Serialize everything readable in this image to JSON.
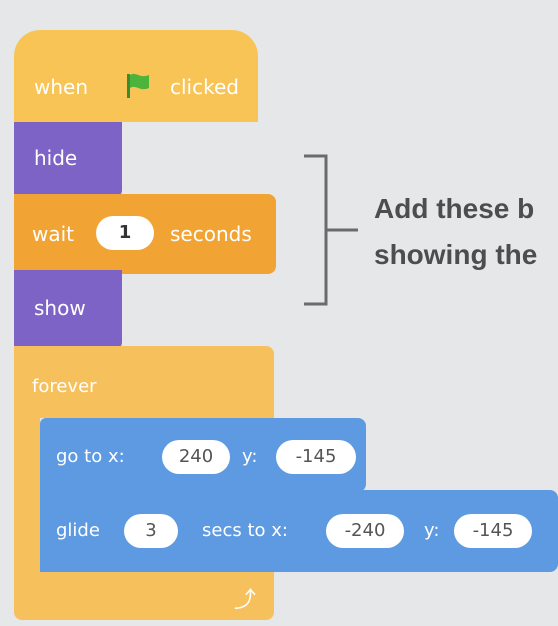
{
  "script": {
    "hat": {
      "when": "when",
      "flag_icon": "green-flag-icon",
      "clicked": "clicked"
    },
    "hide": {
      "label": "hide"
    },
    "wait": {
      "label": "wait",
      "value": "1",
      "unit": "seconds"
    },
    "show": {
      "label": "show"
    },
    "forever": {
      "label": "forever"
    },
    "goto": {
      "label": "go to x:",
      "x": "240",
      "y_label": "y:",
      "y": "-145"
    },
    "glide": {
      "label": "glide",
      "secs": "3",
      "secs_label": "secs to x:",
      "x": "-240",
      "y_label": "y:",
      "y": "-145"
    }
  },
  "annotation": {
    "line1": "Add these b",
    "line2": "showing the"
  },
  "colors": {
    "events": "#f7c455",
    "looks": "#7e63c6",
    "control": "#f1a434",
    "motion": "#5d9ae1",
    "background": "#e6e7e9"
  }
}
